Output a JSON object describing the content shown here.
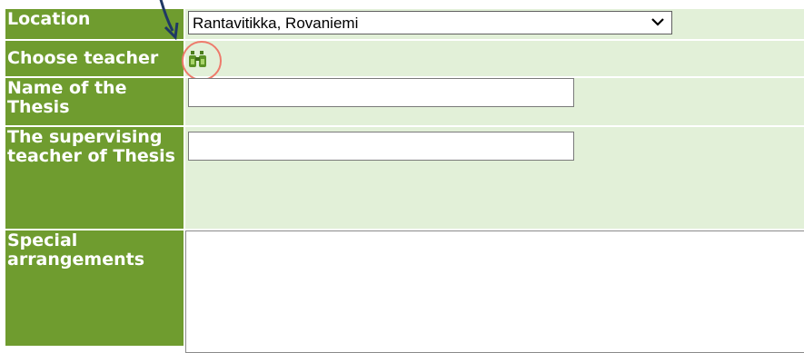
{
  "form": {
    "location": {
      "label": "Location",
      "selected": "Rantavitikka, Rovaniemi"
    },
    "choose_teacher": {
      "label": "Choose teacher"
    },
    "thesis_name": {
      "label": "Name of the Thesis",
      "value": ""
    },
    "supervising_teacher": {
      "label": "The supervising teacher of Thesis",
      "value": ""
    },
    "special_arrangements": {
      "label": "Special arrangements",
      "value": ""
    }
  },
  "icons": {
    "find_teacher": "binoculars-icon",
    "select_toggle": "chevron-down-icon",
    "annotation": "arrow-annotation"
  },
  "colors": {
    "label_bg": "#6f9c2f",
    "label_text": "#ffffff",
    "field_bg": "#e2f0d8",
    "highlight_ring": "#ee7a6b",
    "arrow": "#1f3864"
  }
}
